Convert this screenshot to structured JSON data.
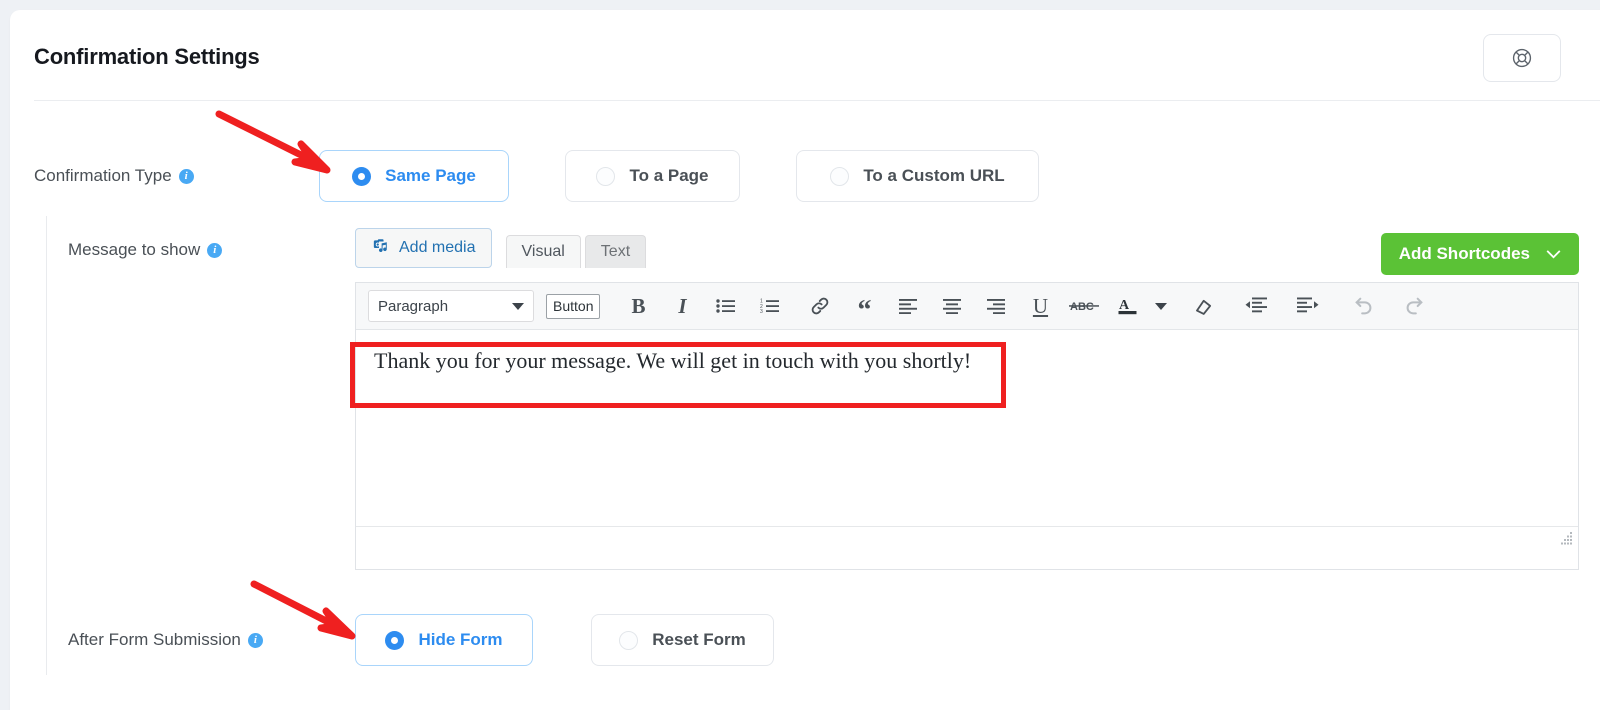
{
  "header": {
    "title": "Confirmation Settings",
    "help_icon": "lifebuoy-icon"
  },
  "confirmation_type": {
    "label": "Confirmation Type",
    "info_glyph": "i",
    "options": [
      {
        "label": "Same Page",
        "selected": true
      },
      {
        "label": "To a Page",
        "selected": false
      },
      {
        "label": "To a Custom URL",
        "selected": false
      }
    ]
  },
  "message_to_show": {
    "label": "Message to show",
    "info_glyph": "i",
    "add_media_label": "Add media",
    "tabs": [
      {
        "label": "Visual",
        "active": true
      },
      {
        "label": "Text",
        "active": false
      }
    ],
    "shortcodes_label": "Add Shortcodes",
    "shortcodes_color": "#5bc236",
    "editor": {
      "format_select_value": "Paragraph",
      "button_tool_label": "Button",
      "tools": [
        "bold-icon",
        "italic-icon",
        "bulleted-list-icon",
        "numbered-list-icon",
        "link-icon",
        "blockquote-icon",
        "align-left-icon",
        "align-center-icon",
        "align-right-icon",
        "underline-icon",
        "strikethrough-icon",
        "text-color-icon",
        "color-dropdown-caret-icon",
        "clear-formatting-icon",
        "outdent-icon",
        "indent-icon",
        "undo-icon",
        "redo-icon"
      ],
      "content": "Thank you for your message. We will get in touch with you shortly!"
    }
  },
  "after_form_submission": {
    "label": "After Form Submission",
    "info_glyph": "i",
    "options": [
      {
        "label": "Hide Form",
        "selected": true
      },
      {
        "label": "Reset Form",
        "selected": false
      }
    ]
  },
  "annotations": {
    "accent_color": "#ef2020",
    "arrow_to_same_page": "red-arrow-icon",
    "arrow_to_hide_form": "red-arrow-icon",
    "highlight_editor_text": "red-highlight-box"
  }
}
